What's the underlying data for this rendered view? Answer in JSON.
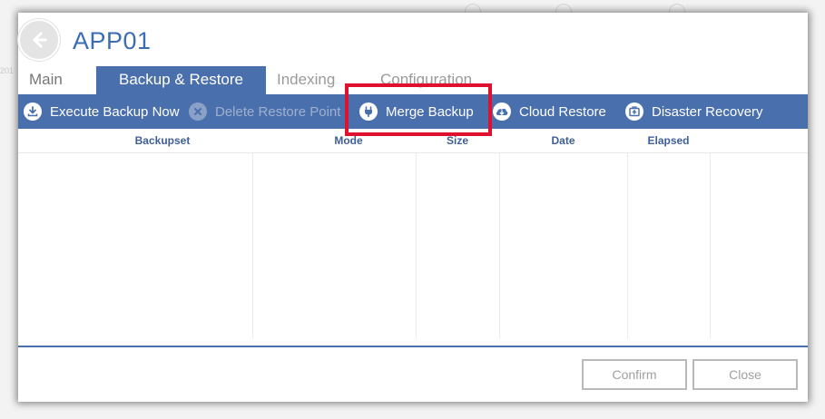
{
  "window": {
    "title": "APP01"
  },
  "tabs": [
    {
      "label": "Main",
      "active": false
    },
    {
      "label": "Backup & Restore",
      "active": true
    },
    {
      "label": "Indexing",
      "active": false
    },
    {
      "label": "Configuration",
      "active": false
    }
  ],
  "toolbar": {
    "items": [
      {
        "label": "Execute Backup Now",
        "icon": "download-icon",
        "enabled": true
      },
      {
        "label": "Delete Restore Point",
        "icon": "close-circle-icon",
        "enabled": false
      },
      {
        "label": "Merge Backup",
        "icon": "plug-icon",
        "enabled": true,
        "highlighted": true
      },
      {
        "label": "Cloud Restore",
        "icon": "cloud-download-icon",
        "enabled": true
      },
      {
        "label": "Disaster Recovery",
        "icon": "first-aid-icon",
        "enabled": true
      }
    ]
  },
  "table": {
    "columns": [
      "Backupset",
      "Mode",
      "Size",
      "Date",
      "Elapsed"
    ],
    "rows": []
  },
  "footer": {
    "confirm_label": "Confirm",
    "close_label": "Close"
  },
  "background": {
    "partial_text": "201"
  },
  "colors": {
    "accent": "#4a6fad",
    "title": "#3b6db7",
    "highlight": "#e0102f",
    "header_text": "#3f5f97"
  }
}
